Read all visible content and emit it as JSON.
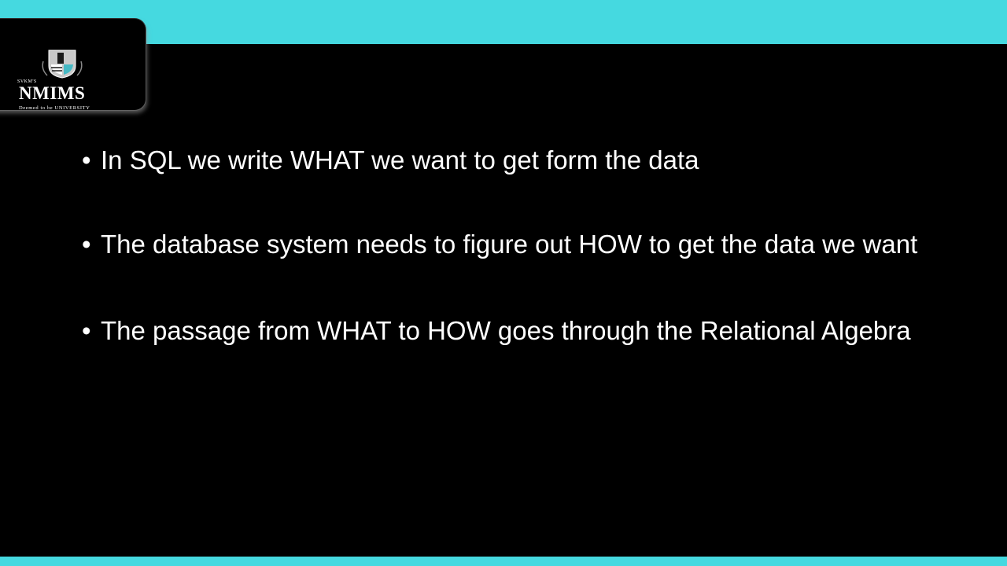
{
  "theme": {
    "accent": "#45d9e0",
    "background": "#000000",
    "text": "#ffffff"
  },
  "logo": {
    "small_text": "SVKM'S",
    "main_text": "NMIMS",
    "sub_text": "Deemed to be UNIVERSITY",
    "icon": "nmims-crest-icon"
  },
  "bullets": [
    {
      "text": "In SQL we write WHAT we want to get form the data"
    },
    {
      "text": "The database system needs to figure out HOW to get the data we want"
    },
    {
      "text": "The passage from WHAT to HOW goes through the Relational Algebra"
    }
  ],
  "bullet_glyph": "•"
}
